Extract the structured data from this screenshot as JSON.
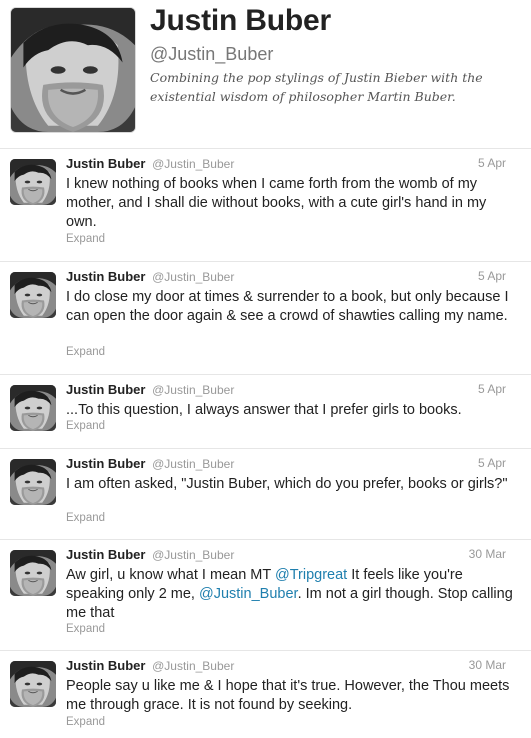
{
  "profile": {
    "name": "Justin Buber",
    "handle": "@Justin_Buber",
    "bio": "Combining the pop stylings of Justin Bieber with the existential wisdom of philosopher Martin Buber."
  },
  "colors": {
    "mention": "#1f7fae",
    "muted": "#999999"
  },
  "tweets": [
    {
      "name": "Justin Buber",
      "handle": "@Justin_Buber",
      "date": "5 Apr",
      "text": "I knew nothing of books when I came forth from the womb of my mother, and I shall die without books, with a cute girl's hand in my own.",
      "expand": "Expand"
    },
    {
      "name": "Justin Buber",
      "handle": "@Justin_Buber",
      "date": "5 Apr",
      "text": "I do close my door at times & surrender to a book, but only because I can open the door again & see a crowd of shawties calling my name.",
      "expand": "Expand"
    },
    {
      "name": "Justin Buber",
      "handle": "@Justin_Buber",
      "date": "5 Apr",
      "text": "...To this question, I always answer that I prefer girls to books.",
      "expand": "Expand"
    },
    {
      "name": "Justin Buber",
      "handle": "@Justin_Buber",
      "date": "5 Apr",
      "text": "I am often asked, \"Justin Buber, which do you prefer, books or girls?\"",
      "expand": "Expand"
    },
    {
      "name": "Justin Buber",
      "handle": "@Justin_Buber",
      "date": "30 Mar",
      "text_before": "Aw girl, u know what I mean MT ",
      "mention1": "@Tripgreat",
      "text_middle": " It feels like you're speaking only 2 me, ",
      "mention2": "@Justin_Buber",
      "text_after": ". Im not a girl though. Stop calling me that",
      "expand": "Expand"
    },
    {
      "name": "Justin Buber",
      "handle": "@Justin_Buber",
      "date": "30 Mar",
      "text": "People say u like me & I hope that it's true. However, the Thou meets me through grace. It is not found by seeking.",
      "expand": "Expand"
    }
  ]
}
